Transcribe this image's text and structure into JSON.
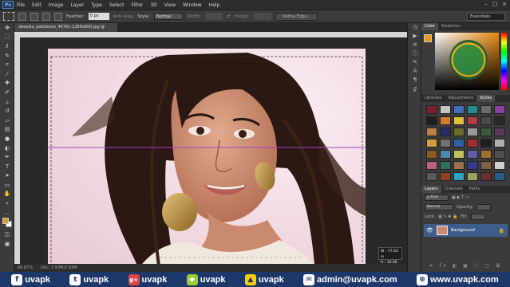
{
  "app": {
    "logo": "Ps",
    "menu": [
      "File",
      "Edit",
      "Image",
      "Layer",
      "Type",
      "Select",
      "Filter",
      "3D",
      "View",
      "Window",
      "Help"
    ],
    "window_controls": [
      "–",
      "□",
      "×"
    ]
  },
  "options": {
    "feather_label": "Feather:",
    "feather_value": "0 px",
    "antialias_label": "Anti-alias",
    "style_label": "Style:",
    "style_value": "Normal",
    "width_label": "Width:",
    "height_label": "Height:",
    "refine_edge": "Refine Edge...",
    "workspace": "Essentials"
  },
  "document": {
    "tab_title": "deepika_padukone_46761-1280x800.jpg @ 66.7% (RGB/8#)",
    "zoom": "66.67%",
    "doc_size": "Doc: 2.93M/2.93M",
    "selection_w": "W : 17.63 in",
    "selection_h": "H : 10.46 in"
  },
  "panels": {
    "color_tabs": [
      "Color",
      "Swatches"
    ],
    "adjust_tabs": [
      "Libraries",
      "Adjustments",
      "Styles"
    ],
    "layer_tabs": [
      "Layers",
      "Channels",
      "Paths"
    ],
    "kind_label": "ρ Kind",
    "blend_mode": "Normal",
    "opacity_label": "Opacity:",
    "lock_label": "Lock:",
    "fill_label": "Fill:",
    "layer_name": "Background"
  },
  "styles_colors": [
    "#7a1f2b",
    "#c4c4c4",
    "#3f6fb5",
    "#2b8a8f",
    "#6b6b6b",
    "#8a3fa0",
    "#1e1e1e",
    "#d97b2a",
    "#e0c040",
    "#b04040",
    "#4a4a4a",
    "#2a2a2a",
    "#c08040",
    "#2a2a6a",
    "#6a6a2a",
    "#9a9a9a",
    "#3a5a3a",
    "#5a3a5a",
    "#d0a040",
    "#707070",
    "#3060a0",
    "#a03030",
    "#202020",
    "#b0b0b0",
    "#8a5a20",
    "#4a8ab0",
    "#c0c060",
    "#6060a0",
    "#a07030",
    "#505050",
    "#c06080",
    "#307060",
    "#9a7050",
    "#3a3a8a",
    "#806040",
    "#d0d0d0",
    "#5a5a5a",
    "#904020",
    "#30a0c0",
    "#a0a060",
    "#6a3030",
    "#2a5a8a"
  ],
  "toolbar_icons": [
    "move-icon",
    "marquee-icon",
    "lasso-icon",
    "quick-select-icon",
    "crop-icon",
    "eyedropper-icon",
    "healing-icon",
    "brush-icon",
    "clone-stamp-icon",
    "history-brush-icon",
    "eraser-icon",
    "gradient-icon",
    "blur-icon",
    "dodge-icon",
    "pen-icon",
    "type-icon",
    "path-select-icon",
    "shape-icon",
    "hand-icon",
    "zoom-icon"
  ],
  "banner": [
    {
      "icon": "f",
      "text": "uvapk",
      "name": "facebook"
    },
    {
      "icon": "t",
      "text": "uvapk",
      "name": "twitter"
    },
    {
      "icon": "g+",
      "text": "uvapk",
      "name": "google-plus"
    },
    {
      "icon": "◆",
      "text": "uvapk",
      "name": "android"
    },
    {
      "icon": "▲",
      "text": "uvapk",
      "name": "triangle"
    },
    {
      "icon": "✉",
      "text": "admin@uvapk.com",
      "name": "email"
    },
    {
      "icon": "⊕",
      "text": "www.uvapk.com",
      "name": "web"
    }
  ]
}
